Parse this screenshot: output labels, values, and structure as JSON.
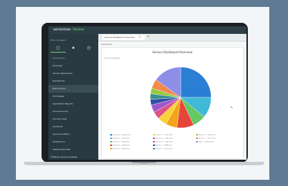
{
  "app": {
    "brand": "servicenow",
    "brand_sub": "Service"
  },
  "sidebar": {
    "filter_placeholder": "Filter navigator",
    "icons": [
      "home-icon",
      "star-icon",
      "history-icon"
    ],
    "items": [
      {
        "label": "Dashboards"
      },
      {
        "label": "Overview"
      },
      {
        "label": "Service Operations"
      },
      {
        "label": "Dashboards"
      },
      {
        "label": "Dell's Studio"
      },
      {
        "label": "Homepage"
      },
      {
        "label": "Application Reports"
      },
      {
        "label": "Cloud Services"
      },
      {
        "label": "Connect Chat"
      },
      {
        "label": "Contracts"
      },
      {
        "label": "Service Portfolio"
      },
      {
        "label": "Self-Service"
      },
      {
        "label": "Assignment Lists"
      },
      {
        "label": "Metrics Service Catalog"
      },
      {
        "label": "Service Catalog"
      }
    ],
    "bottom_icon": "filter-icon"
  },
  "main": {
    "tab_label": "Service Dashboard Overview",
    "tab_close": "×",
    "tab_add": "+",
    "subheader": "Dashboard",
    "report_title": "Service Dashboard Overview",
    "report_sub": "Service Details"
  },
  "chart_data": {
    "type": "pie",
    "values": [
      25,
      11,
      7,
      9,
      6,
      5,
      4,
      4,
      3,
      3,
      3,
      5,
      15
    ],
    "colors": [
      "#2a7fd4",
      "#3fb9d6",
      "#64c964",
      "#e7453a",
      "#f4a41a",
      "#f7d33a",
      "#e0508b",
      "#9e57c9",
      "#2f4ea6",
      "#3a8f8f",
      "#95c93d",
      "#f28b4d",
      "#8c8ee8"
    ]
  },
  "legend": {
    "entries": [
      "Service A — 11,473 items",
      "Service B — 9,127 items",
      "Service C — 6,812 items",
      "Service D — 5,904 items",
      "Service E — 4,208 items",
      "Service F — 3,517 items",
      "Service G — 2,946 items",
      "Service H — 2,301 items",
      "Service I — 1,884 items",
      "Service J — 1,512 items",
      "Service K — 1,263 items",
      "Service L — 1,027 items",
      "Other — 14,722 items"
    ]
  },
  "device": {
    "label": "MacBook Air"
  }
}
